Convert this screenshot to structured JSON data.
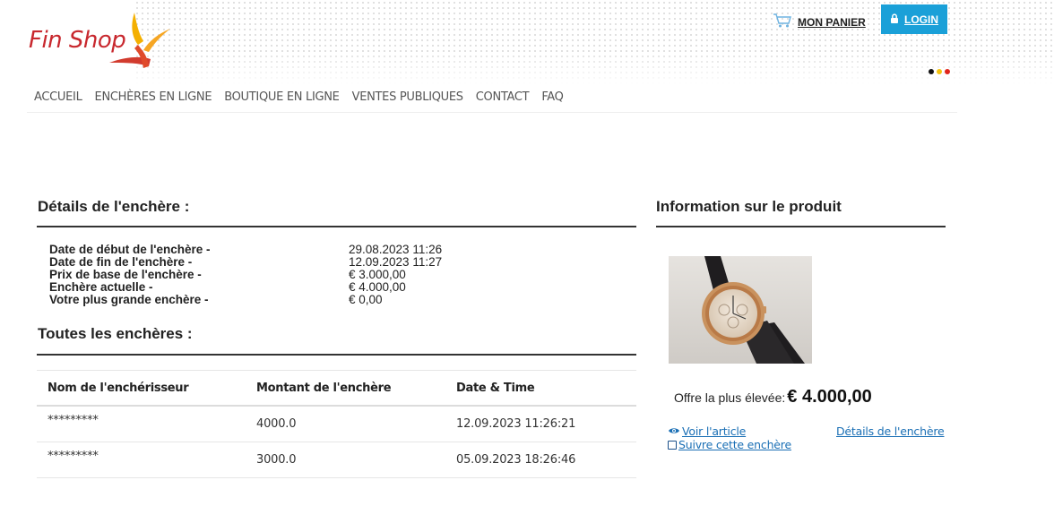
{
  "brand": {
    "name": "Fin Shop"
  },
  "header": {
    "cart_label": "MON PANIER",
    "login_label": "LOGIN",
    "flag_colors": [
      "#111111",
      "#f4c20d",
      "#e1251b"
    ]
  },
  "nav": {
    "items": [
      {
        "label": "ACCUEIL"
      },
      {
        "label": "ENCHÈRES EN LIGNE"
      },
      {
        "label": "BOUTIQUE EN LIGNE"
      },
      {
        "label": "VENTES PUBLIQUES"
      },
      {
        "label": "CONTACT"
      },
      {
        "label": "FAQ"
      }
    ]
  },
  "auction_details": {
    "title": "Détails de l'enchère :",
    "rows": [
      {
        "label": "Date de début de l'enchère -",
        "value": "29.08.2023 11:26"
      },
      {
        "label": "Date de fin de l'enchère -",
        "value": "12.09.2023 11:27"
      },
      {
        "label": "Prix de base de l'enchère -",
        "value": "€ 3.000,00"
      },
      {
        "label": "Enchère actuelle -",
        "value": "€ 4.000,00"
      },
      {
        "label": "Votre plus grande enchère -",
        "value": "€ 0,00"
      }
    ]
  },
  "bids": {
    "title": "Toutes les enchères :",
    "headers": [
      "Nom de l'enchérisseur",
      "Montant de l'enchère",
      "Date & Time"
    ],
    "rows": [
      {
        "name": "*********",
        "amount": "4000.0",
        "datetime": "12.09.2023 11:26:21"
      },
      {
        "name": "*********",
        "amount": "3000.0",
        "datetime": "05.09.2023 18:26:46"
      }
    ]
  },
  "product": {
    "title": "Information sur le produit",
    "offer_label": "Offre la plus élevée:",
    "offer_value": "€ 4.000,00",
    "view_label": "Voir l'article",
    "follow_label": "Suivre cette enchère",
    "details_label": "Détails de l'enchère"
  },
  "colors": {
    "accent": "#1aa0d8",
    "brand_red": "#c8282e",
    "link": "#1a6fb5"
  }
}
